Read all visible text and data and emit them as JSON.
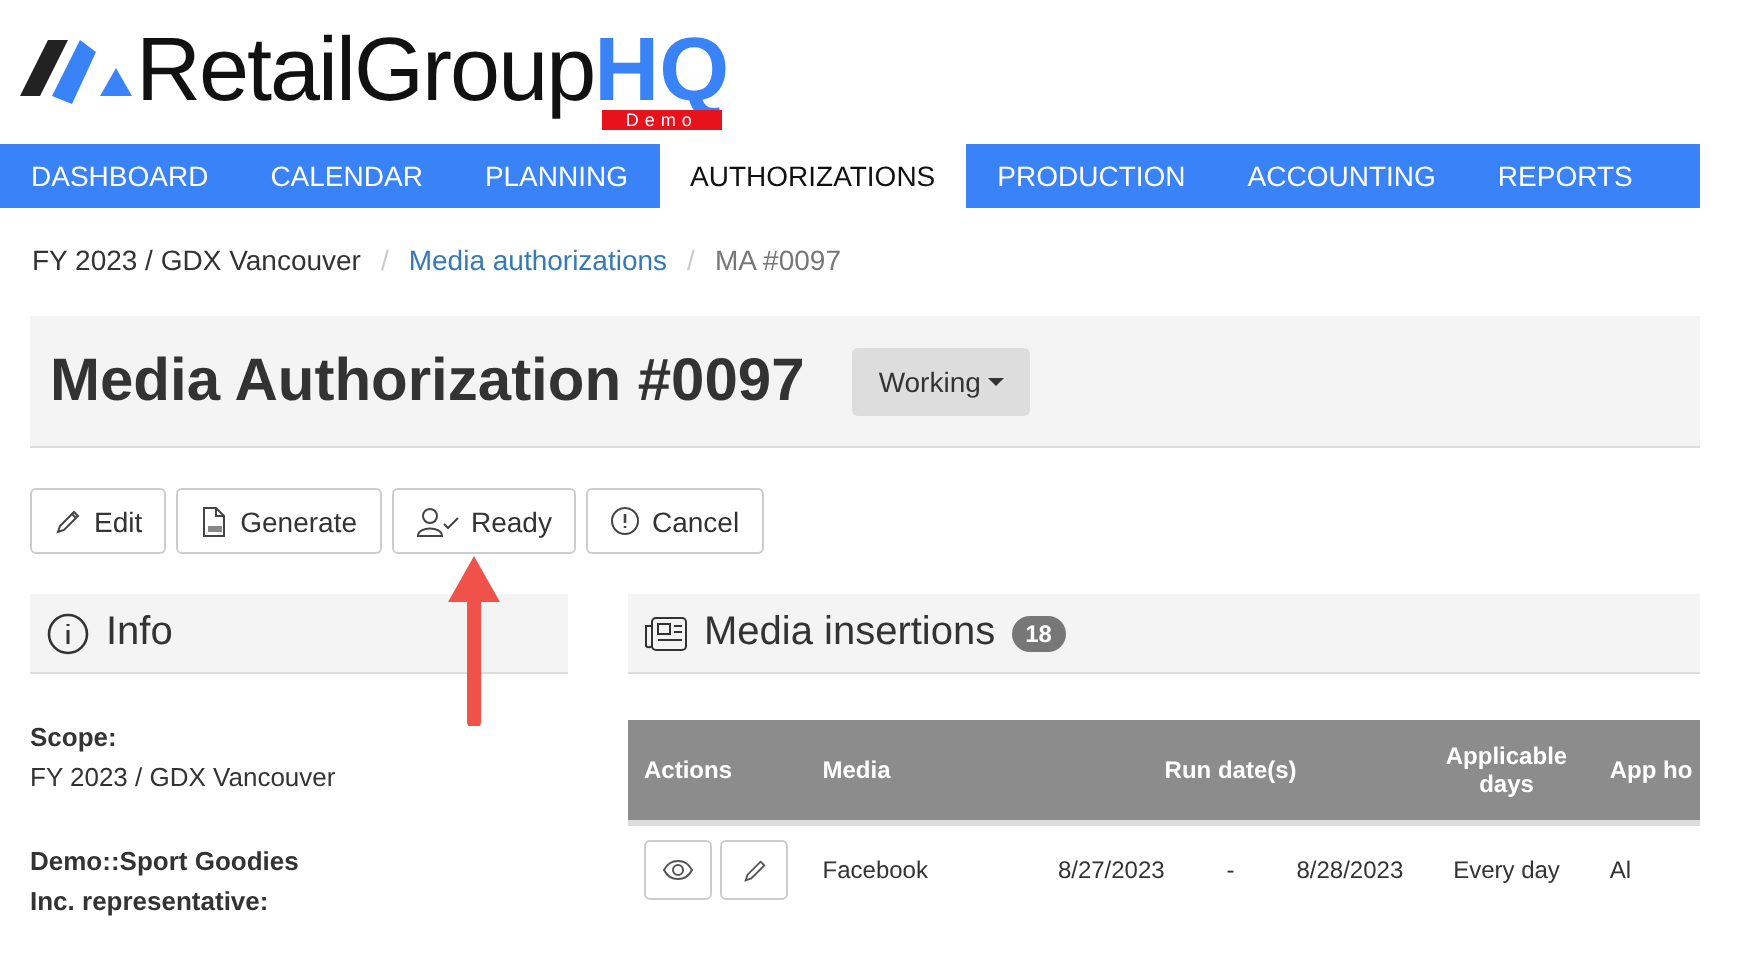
{
  "logo": {
    "name": "RetailGroup",
    "suffix": "HQ",
    "badge": "Demo"
  },
  "nav": [
    {
      "label": "DASHBOARD",
      "selected": false
    },
    {
      "label": "CALENDAR",
      "selected": false
    },
    {
      "label": "PLANNING",
      "selected": false
    },
    {
      "label": "AUTHORIZATIONS",
      "selected": true
    },
    {
      "label": "PRODUCTION",
      "selected": false
    },
    {
      "label": "ACCOUNTING",
      "selected": false
    },
    {
      "label": "REPORTS",
      "selected": false
    }
  ],
  "breadcrumb": [
    {
      "label": "FY 2023 / GDX Vancouver",
      "kind": "text"
    },
    {
      "label": "/",
      "kind": "separator"
    },
    {
      "label": "Media authorizations",
      "kind": "link"
    },
    {
      "label": "/",
      "kind": "separator"
    },
    {
      "label": "MA #0097",
      "kind": "current"
    }
  ],
  "page_title": "Media Authorization #0097",
  "status_dropdown": "Working",
  "actions": [
    {
      "label": "Edit",
      "kind": "edit"
    },
    {
      "label": "Generate",
      "kind": "pdf"
    },
    {
      "label": "Ready",
      "kind": "ready"
    },
    {
      "label": "Cancel",
      "kind": "cancel"
    }
  ],
  "info": {
    "title": "Info",
    "fields": [
      {
        "label": "Scope:",
        "value": "FY 2023 / GDX Vancouver"
      },
      {
        "label": "Demo::Sport Goodies Inc. representative:"
      }
    ]
  },
  "insertions": {
    "title": "Media insertions",
    "count": "18",
    "table": {
      "columns": [
        "Actions",
        "Media",
        "Run date(s)",
        "Applicable days",
        "App ho"
      ],
      "rows": [
        {
          "media": "Facebook",
          "start": "8/27/2023",
          "separator": "-",
          "end": "8/28/2023",
          "days": "Every day",
          "column_5": "Al"
        }
      ]
    }
  }
}
